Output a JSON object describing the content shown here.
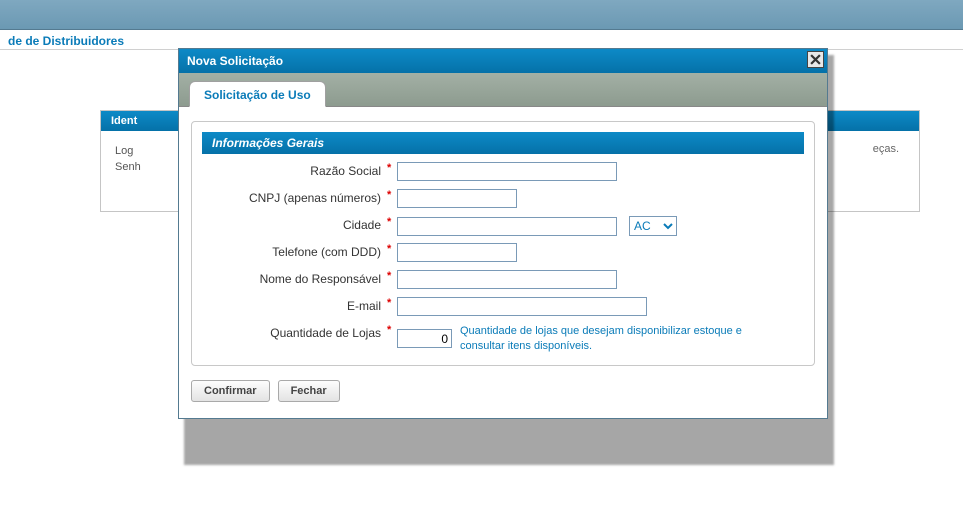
{
  "page": {
    "link_text": "de de Distribuidores"
  },
  "bg_panel": {
    "header": "Ident",
    "row1": "Log",
    "row2": "Senh",
    "right_text": "eças."
  },
  "modal": {
    "title": "Nova Solicitação",
    "tab": "Solicitação de Uso",
    "section": "Informações Gerais",
    "fields": {
      "razao": {
        "label": "Razão Social",
        "value": ""
      },
      "cnpj": {
        "label": "CNPJ (apenas números)",
        "value": ""
      },
      "cidade": {
        "label": "Cidade",
        "value": ""
      },
      "uf": {
        "selected": "AC"
      },
      "telefone": {
        "label": "Telefone (com DDD)",
        "value": ""
      },
      "responsavel": {
        "label": "Nome do Responsável",
        "value": ""
      },
      "email": {
        "label": "E-mail",
        "value": ""
      },
      "qtd": {
        "label": "Quantidade de Lojas",
        "value": "0",
        "help": "Quantidade de lojas que desejam disponibilizar estoque e consultar itens disponíveis."
      }
    },
    "buttons": {
      "confirm": "Confirmar",
      "close": "Fechar"
    }
  }
}
